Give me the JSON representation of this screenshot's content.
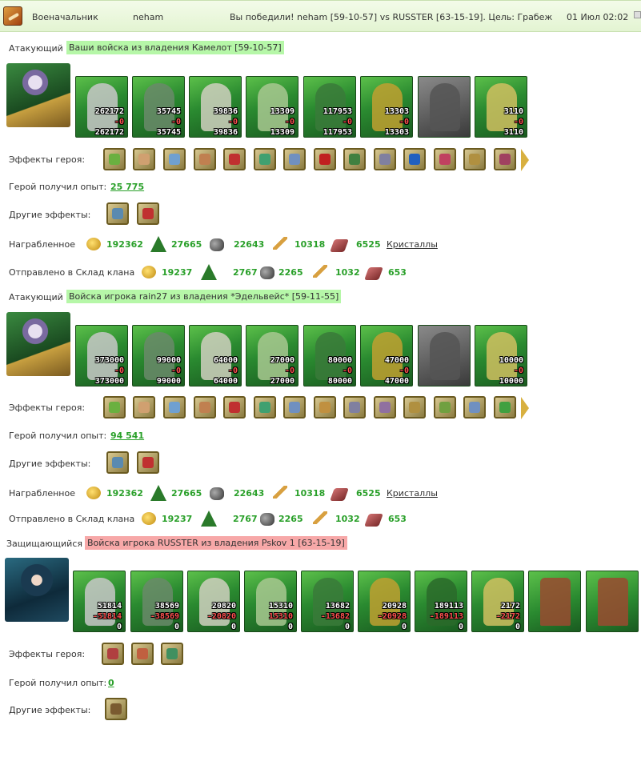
{
  "header": {
    "role": "Военачальник",
    "player": "neham",
    "result": "Вы победили! neham [59-10-57] vs RUSSTER [63-15-19]. Цель: Грабеж",
    "datetime": "01 Июл 02:02"
  },
  "labels": {
    "attacker": "Атакующий",
    "defender": "Защищающийся",
    "hero_effects": "Эффекты героя:",
    "exp_gained": "Герой получил опыт:",
    "other_effects": "Другие эффекты:",
    "looted": "Награбленное",
    "sent_to_clan": "Отправлено в Склад клана",
    "crystals": "Кристаллы"
  },
  "armies": [
    {
      "tag": "Ваши войска из владения Камелот [59-10-57]",
      "units": [
        {
          "top": "262172",
          "mid": "-0",
          "bot": "262172"
        },
        {
          "top": "35745",
          "mid": "-0",
          "bot": "35745"
        },
        {
          "top": "39836",
          "mid": "-0",
          "bot": "39836"
        },
        {
          "top": "13309",
          "mid": "-0",
          "bot": "13309"
        },
        {
          "top": "117953",
          "mid": "-0",
          "bot": "117953"
        },
        {
          "top": "13303",
          "mid": "-0",
          "bot": "13303"
        },
        {
          "top": "",
          "mid": "",
          "bot": ""
        },
        {
          "top": "3110",
          "mid": "-0",
          "bot": "3110"
        }
      ],
      "exp": "25 775",
      "loot": [
        "192362",
        "27665",
        "22643",
        "10318",
        "6525"
      ],
      "sent": [
        "19237",
        "2767",
        "2265",
        "1032",
        "653"
      ]
    },
    {
      "tag": "Войска игрока rain27 из владения *Эдельвейс* [59-11-55]",
      "units": [
        {
          "top": "373000",
          "mid": "-0",
          "bot": "373000"
        },
        {
          "top": "99000",
          "mid": "-0",
          "bot": "99000"
        },
        {
          "top": "64000",
          "mid": "-0",
          "bot": "64000"
        },
        {
          "top": "27000",
          "mid": "-0",
          "bot": "27000"
        },
        {
          "top": "80000",
          "mid": "-0",
          "bot": "80000"
        },
        {
          "top": "47000",
          "mid": "-0",
          "bot": "47000"
        },
        {
          "top": "",
          "mid": "",
          "bot": ""
        },
        {
          "top": "10000",
          "mid": "-0",
          "bot": "10000"
        }
      ],
      "exp": "94 541",
      "loot": [
        "192362",
        "27665",
        "22643",
        "10318",
        "6525"
      ],
      "sent": [
        "19237",
        "2767",
        "2265",
        "1032",
        "653"
      ]
    },
    {
      "tag": "Войска игрока RUSSTER из владения Pskov 1 [63-15-19]",
      "units": [
        {
          "top": "51814",
          "mid": "-51814",
          "bot": "0"
        },
        {
          "top": "38569",
          "mid": "-38569",
          "bot": "0"
        },
        {
          "top": "20820",
          "mid": "-20820",
          "bot": "0"
        },
        {
          "top": "15310",
          "mid": "15310",
          "bot": "0"
        },
        {
          "top": "13682",
          "mid": "-13682",
          "bot": "0"
        },
        {
          "top": "20928",
          "mid": "-20928",
          "bot": "0"
        },
        {
          "top": "189113",
          "mid": "-189113",
          "bot": "0"
        },
        {
          "top": "2172",
          "mid": "-2172",
          "bot": "0"
        },
        {
          "top": "",
          "mid": "",
          "bot": ""
        },
        {
          "top": "",
          "mid": "",
          "bot": ""
        }
      ],
      "exp": "0"
    }
  ]
}
